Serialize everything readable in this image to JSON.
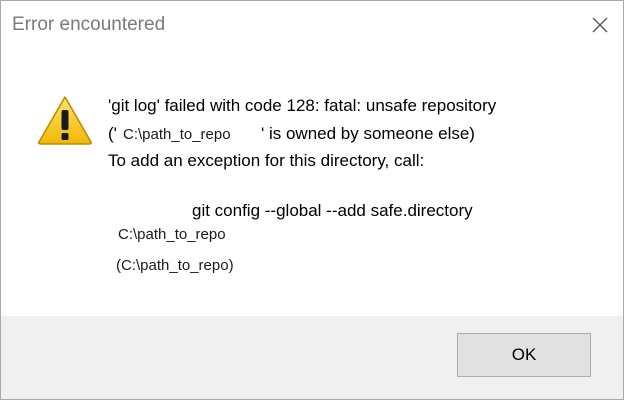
{
  "window": {
    "title": "Error encountered",
    "close_icon": "close-icon"
  },
  "message": {
    "icon": "warning-icon",
    "line1": "'git log' failed with code 128: fatal: unsafe repository",
    "line2_open": "('",
    "line2_path": "C:\\path_to_repo",
    "line2_rest": "' is owned by someone else)",
    "line3": "To add an exception for this directory, call:",
    "command": "git config --global --add safe.directory",
    "command_path": "C:\\path_to_repo",
    "paren_path": "(C:\\path_to_repo)"
  },
  "buttons": {
    "ok_label": "OK"
  }
}
